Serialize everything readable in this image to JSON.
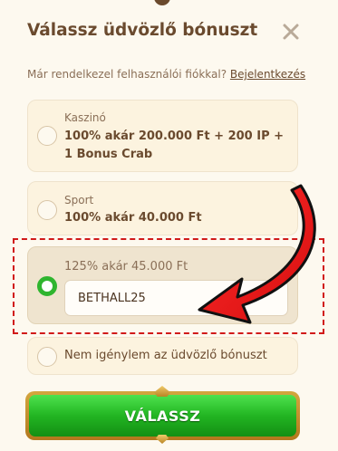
{
  "header": {
    "title": "Válassz üdvözlő bónuszt"
  },
  "login": {
    "question": "Már rendelkezel felhasználói fiókkal?",
    "link": "Bejelentkezés"
  },
  "options": [
    {
      "label": "Kaszinó",
      "value": "100% akár 200.000 Ft + 200 IP + 1 Bonus Crab",
      "selected": false
    },
    {
      "label": "Sport",
      "value": "100% akár 40.000 Ft",
      "selected": false
    },
    {
      "label": "125% akár 45.000 Ft",
      "promo_code": "BETHALL25",
      "selected": true
    },
    {
      "value": "Nem igénylem az üdvözlő bónuszt",
      "selected": false
    }
  ],
  "cta": {
    "label": "VÁLASSZ"
  },
  "colors": {
    "background": "#fdf9ef",
    "text_brown": "#6a4a2e",
    "selected_green": "#2fb52f",
    "annotation_red": "#d11a1a",
    "cta_green": "#22b522",
    "cta_gold": "#c8932e"
  },
  "icons": {
    "close": "close-icon",
    "annotation_arrow": "arrow-icon"
  }
}
